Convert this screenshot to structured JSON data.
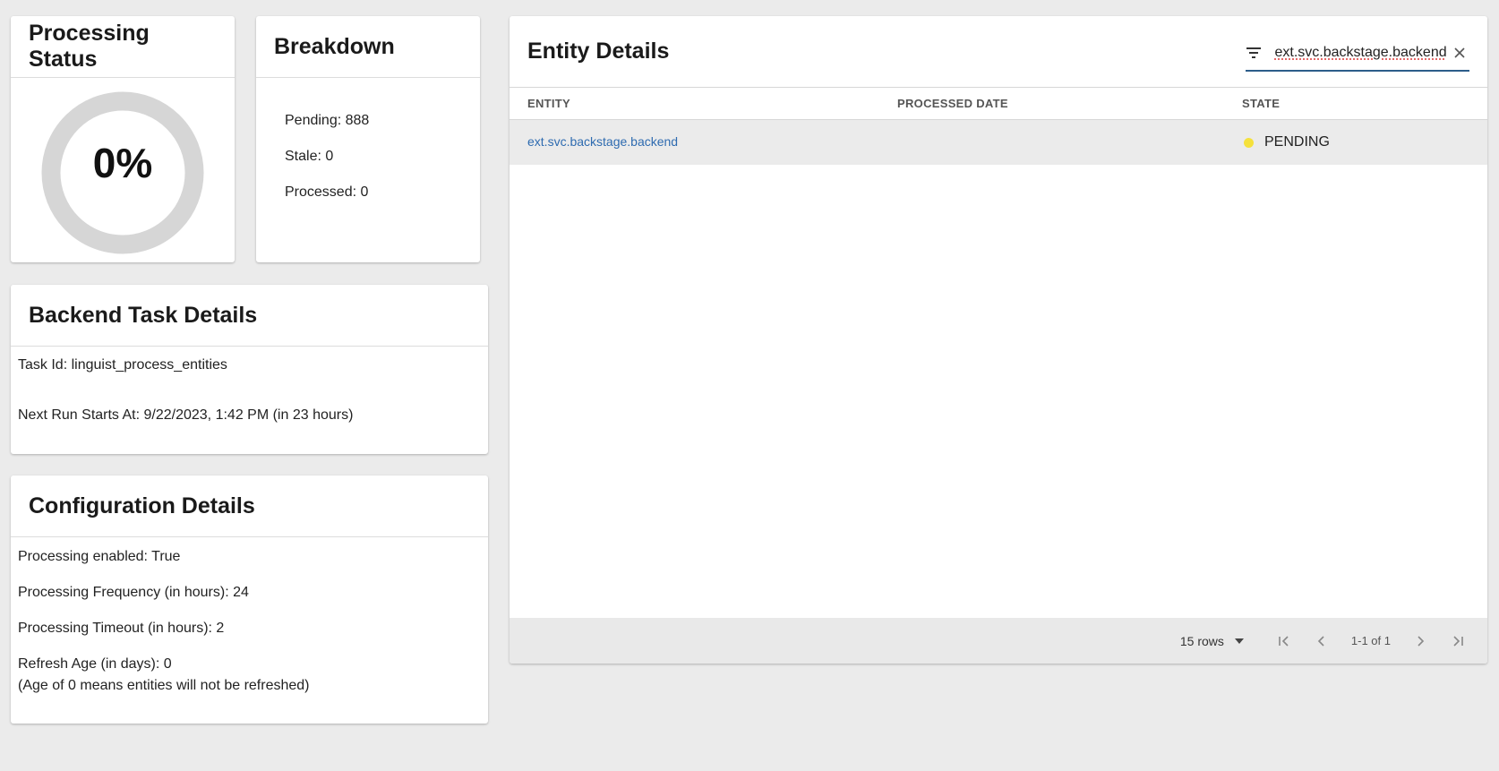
{
  "status_card": {
    "title": "Processing Status",
    "percent_label": "0%",
    "ring_color": "#d6d6d6"
  },
  "breakdown": {
    "title": "Breakdown",
    "items": [
      "Pending: 888",
      "Stale: 0",
      "Processed: 0"
    ]
  },
  "task": {
    "title": "Backend Task Details",
    "task_id": "Task Id: linguist_process_entities",
    "next_run": "Next Run Starts At: 9/22/2023, 1:42 PM (in 23 hours)"
  },
  "config": {
    "title": "Configuration Details",
    "enabled": "Processing enabled: True",
    "frequency": "Processing Frequency (in hours): 24",
    "timeout": "Processing Timeout (in hours): 2",
    "refresh_age": "Refresh Age (in days): 0",
    "refresh_note": "(Age of 0 means entities will not be refreshed)"
  },
  "entity_details": {
    "title": "Entity Details",
    "filter": {
      "value": "ext.svc.backstage.backend",
      "icon": "filter-icon",
      "clear_icon": "close-icon"
    },
    "columns": [
      "ENTITY",
      "PROCESSED DATE",
      "STATE"
    ],
    "rows": [
      {
        "entity": "ext.svc.backstage.backend",
        "processed_date": "",
        "state": "PENDING",
        "state_color": "#f5e13c"
      }
    ],
    "pagination": {
      "rows_per_page": "15 rows",
      "page_info": "1-1 of 1"
    },
    "link_color": "#2e6bb0",
    "accent_color": "#2c5d8a"
  }
}
